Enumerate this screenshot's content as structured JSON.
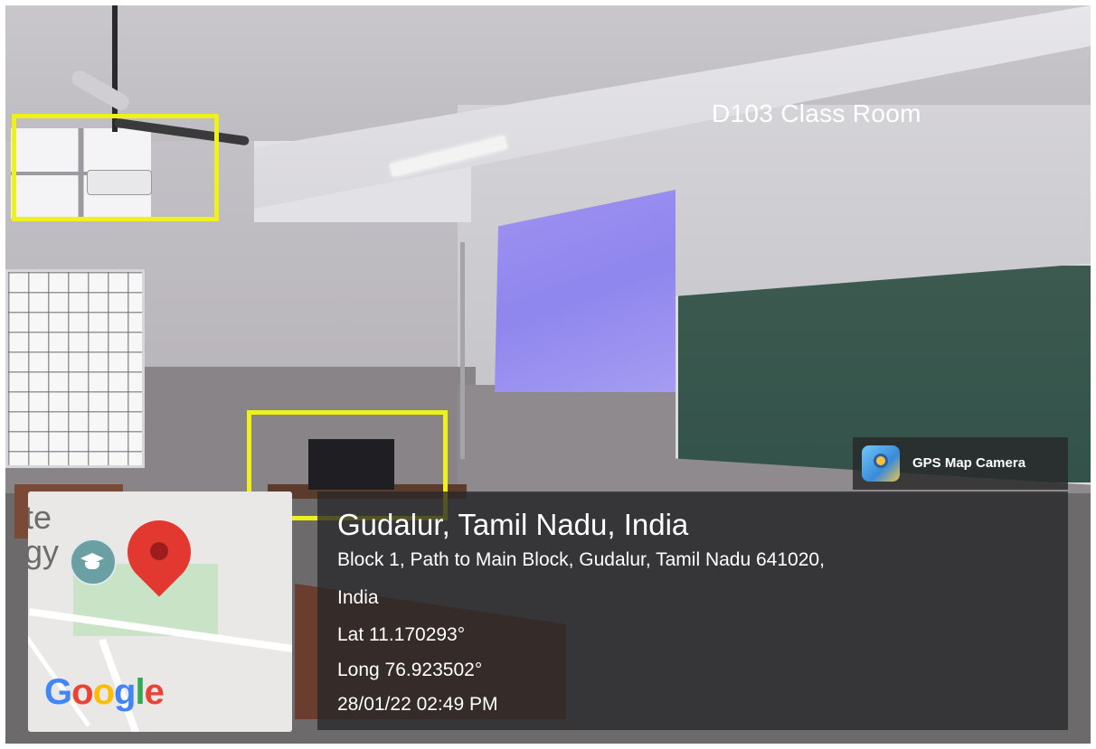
{
  "photo": {
    "room_label": "D103 Class Room",
    "highlight_color": "#f0f11a"
  },
  "gps_badge": {
    "app_name": "GPS Map Camera",
    "icon": "gps-map-camera-icon"
  },
  "location": {
    "title": "Gudalur, Tamil Nadu, India",
    "address_line1": "Block 1, Path to Main Block, Gudalur, Tamil Nadu 641020,",
    "address_line2": "India",
    "latitude": "Lat 11.170293°",
    "longitude": "Long 76.923502°",
    "datetime": "28/01/22 02:49 PM"
  },
  "map": {
    "text_fragment": "te\ngy",
    "pin_color": "#e3382f",
    "logo_letters": [
      "G",
      "o",
      "o",
      "g",
      "l",
      "e"
    ],
    "icons": [
      "education-icon",
      "map-pin-icon"
    ]
  }
}
